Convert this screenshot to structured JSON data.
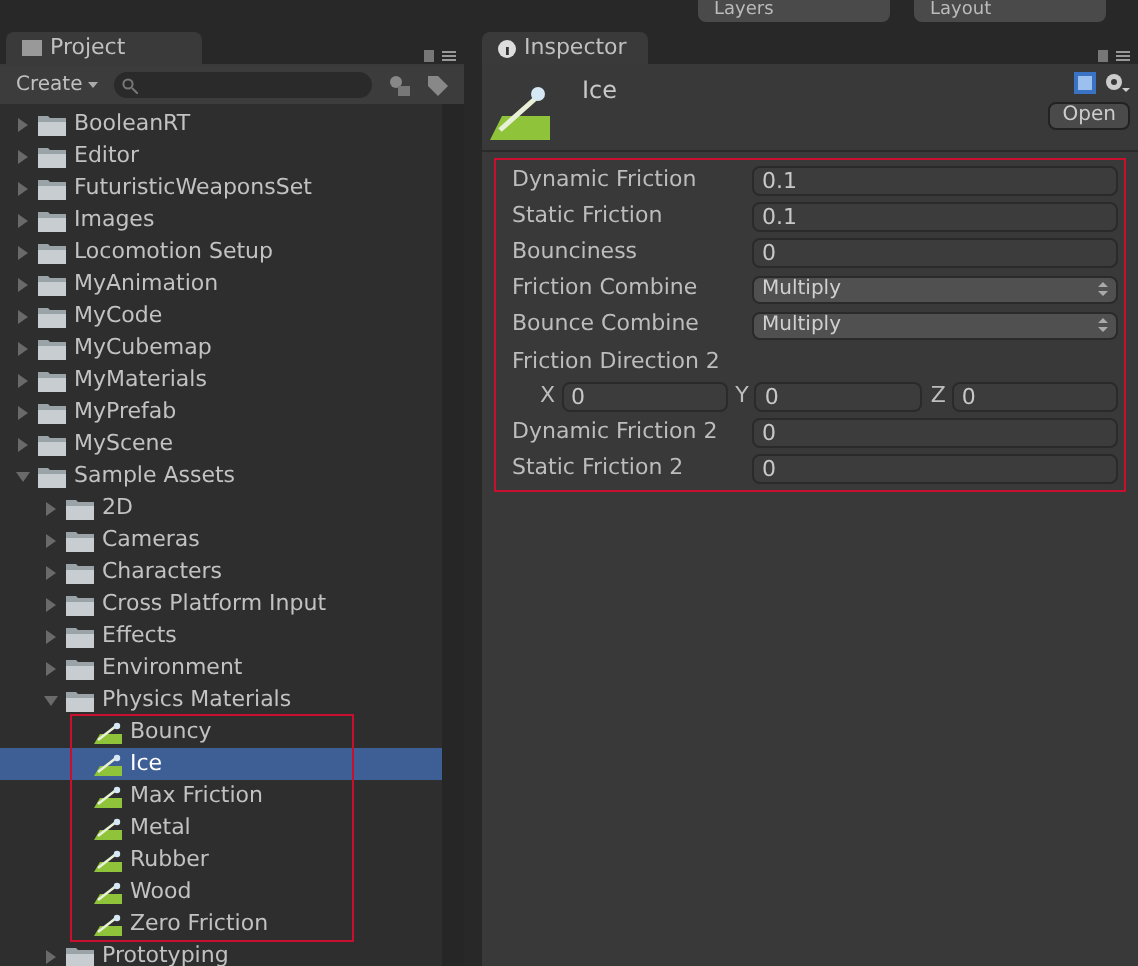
{
  "toolbar": {
    "dropdowns": [
      "Layers",
      "Layout"
    ]
  },
  "project_panel": {
    "tab": "Project",
    "create_button": "Create",
    "tree": [
      {
        "label": "BooleanRT",
        "kind": "folder",
        "expanded": false
      },
      {
        "label": "Editor",
        "kind": "folder",
        "expanded": false
      },
      {
        "label": "FuturisticWeaponsSet",
        "kind": "folder",
        "expanded": false
      },
      {
        "label": "Images",
        "kind": "folder",
        "expanded": false
      },
      {
        "label": "Locomotion Setup",
        "kind": "folder",
        "expanded": false
      },
      {
        "label": "MyAnimation",
        "kind": "folder",
        "expanded": false
      },
      {
        "label": "MyCode",
        "kind": "folder",
        "expanded": false
      },
      {
        "label": "MyCubemap",
        "kind": "folder",
        "expanded": false
      },
      {
        "label": "MyMaterials",
        "kind": "folder",
        "expanded": false
      },
      {
        "label": "MyPrefab",
        "kind": "folder",
        "expanded": false
      },
      {
        "label": "MyScene",
        "kind": "folder",
        "expanded": false
      },
      {
        "label": "Sample Assets",
        "kind": "folder",
        "expanded": true,
        "children": [
          {
            "label": "2D",
            "kind": "folder",
            "expanded": false
          },
          {
            "label": "Cameras",
            "kind": "folder",
            "expanded": false
          },
          {
            "label": "Characters",
            "kind": "folder",
            "expanded": false
          },
          {
            "label": "Cross Platform Input",
            "kind": "folder",
            "expanded": false
          },
          {
            "label": "Effects",
            "kind": "folder",
            "expanded": false
          },
          {
            "label": "Environment",
            "kind": "folder",
            "expanded": false
          },
          {
            "label": "Physics Materials",
            "kind": "folder",
            "expanded": true,
            "children": [
              {
                "label": "Bouncy",
                "kind": "material",
                "selected": false
              },
              {
                "label": "Ice",
                "kind": "material",
                "selected": true
              },
              {
                "label": "Max Friction",
                "kind": "material",
                "selected": false
              },
              {
                "label": "Metal",
                "kind": "material",
                "selected": false
              },
              {
                "label": "Rubber",
                "kind": "material",
                "selected": false
              },
              {
                "label": "Wood",
                "kind": "material",
                "selected": false
              },
              {
                "label": "Zero Friction",
                "kind": "material",
                "selected": false
              }
            ]
          },
          {
            "label": "Prototyping",
            "kind": "folder",
            "expanded": false
          }
        ]
      }
    ]
  },
  "inspector": {
    "tab": "Inspector",
    "asset_name": "Ice",
    "open_button": "Open",
    "properties": [
      {
        "kind": "number",
        "label": "Dynamic Friction",
        "value": "0.1"
      },
      {
        "kind": "number",
        "label": "Static Friction",
        "value": "0.1"
      },
      {
        "kind": "number",
        "label": "Bounciness",
        "value": "0"
      },
      {
        "kind": "dropdown",
        "label": "Friction Combine",
        "value": "Multiply"
      },
      {
        "kind": "dropdown",
        "label": "Bounce Combine",
        "value": "Multiply"
      },
      {
        "kind": "vector",
        "label": "Friction Direction 2",
        "components": [
          {
            "axis": "X",
            "value": "0"
          },
          {
            "axis": "Y",
            "value": "0"
          },
          {
            "axis": "Z",
            "value": "0"
          }
        ]
      },
      {
        "kind": "number",
        "label": "Dynamic Friction 2",
        "value": "0"
      },
      {
        "kind": "number",
        "label": "Static Friction 2",
        "value": "0"
      }
    ]
  }
}
